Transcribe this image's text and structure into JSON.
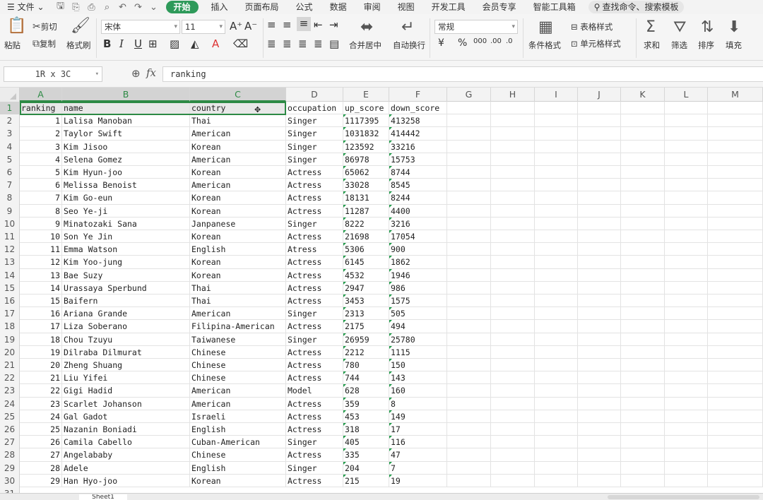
{
  "menu": {
    "file": "文件",
    "items": [
      "开始",
      "插入",
      "页面布局",
      "公式",
      "数据",
      "审阅",
      "视图",
      "开发工具",
      "会员专享",
      "智能工具箱"
    ],
    "active": "开始",
    "search": "查找命令、搜索模板"
  },
  "ribbon": {
    "paste": "粘贴",
    "cut": "剪切",
    "copy": "复制",
    "format_painter": "格式刷",
    "font_name": "宋体",
    "font_size": "11",
    "merge_center": "合并居中",
    "wrap_text": "自动换行",
    "number_format": "常规",
    "conditional_format": "条件格式",
    "table_style": "表格样式",
    "cell_style": "单元格样式",
    "sum": "求和",
    "filter": "筛选",
    "sort": "排序",
    "fill": "填充"
  },
  "formula_bar": {
    "name_box": "1R x 3C",
    "fx": "fx",
    "content": "ranking"
  },
  "columns": [
    "A",
    "B",
    "C",
    "D",
    "E",
    "F",
    "G",
    "H",
    "I",
    "J",
    "K",
    "L",
    "M"
  ],
  "selected_columns": [
    "A",
    "B",
    "C"
  ],
  "selected_row": 1,
  "sheet": {
    "header": [
      "ranking",
      "name",
      "country",
      "occupation",
      "up_score",
      "down_score"
    ],
    "rows": [
      [
        "1",
        "Lalisa Manoban",
        "Thai",
        "Singer",
        "1117395",
        "413258"
      ],
      [
        "2",
        "Taylor Swift",
        "American",
        "Singer",
        "1031832",
        "414442"
      ],
      [
        "3",
        "Kim Jisoo",
        "Korean",
        "Singer",
        "123592",
        "33216"
      ],
      [
        "4",
        "Selena Gomez",
        "American",
        "Singer",
        "86978",
        "15753"
      ],
      [
        "5",
        "Kim Hyun-joo",
        "Korean",
        "Actress",
        "65062",
        "8744"
      ],
      [
        "6",
        "Melissa Benoist",
        "American",
        "Actress",
        "33028",
        "8545"
      ],
      [
        "7",
        "Kim Go-eun",
        "Korean",
        "Actress",
        "18131",
        "8244"
      ],
      [
        "8",
        "Seo Ye-ji",
        "Korean",
        "Actress",
        "11287",
        "4400"
      ],
      [
        "9",
        "Minatozaki Sana",
        "Janpanese",
        "Singer",
        "8222",
        "3216"
      ],
      [
        "10",
        "Son Ye Jin",
        "Korean",
        "Actress",
        "21698",
        "17054"
      ],
      [
        "11",
        "Emma Watson",
        "English",
        "Atress",
        "5306",
        "900"
      ],
      [
        "12",
        "Kim Yoo-jung",
        "Korean",
        "Actress",
        "6145",
        "1862"
      ],
      [
        "13",
        "Bae Suzy",
        "Korean",
        "Actress",
        "4532",
        "1946"
      ],
      [
        "14",
        "Urassaya Sperbund",
        "Thai",
        "Actress",
        "2947",
        "986"
      ],
      [
        "15",
        "Baifern",
        "Thai",
        "Actress",
        "3453",
        "1575"
      ],
      [
        "16",
        "Ariana Grande",
        "American",
        "Singer",
        "2313",
        "505"
      ],
      [
        "17",
        "Liza Soberano",
        "Filipina-American",
        "Actress",
        "2175",
        "494"
      ],
      [
        "18",
        "Chou Tzuyu",
        "Taiwanese",
        "Singer",
        "26959",
        "25780"
      ],
      [
        "19",
        "Dilraba Dilmurat",
        "Chinese",
        "Actress",
        "2212",
        "1115"
      ],
      [
        "20",
        "Zheng Shuang",
        "Chinese",
        "Actress",
        "780",
        "150"
      ],
      [
        "21",
        "Liu Yifei",
        "Chinese",
        "Actress",
        "744",
        "143"
      ],
      [
        "22",
        "Gigi Hadid",
        "American",
        "Model",
        "628",
        "160"
      ],
      [
        "23",
        "Scarlet Johanson",
        "American",
        "Actress",
        "359",
        "8"
      ],
      [
        "24",
        "Gal Gadot",
        "Israeli",
        "Actress",
        "453",
        "149"
      ],
      [
        "25",
        "Nazanin Boniadi",
        "English",
        "Actress",
        "318",
        "17"
      ],
      [
        "26",
        "Camila Cabello",
        "Cuban-American",
        "Singer",
        "405",
        "116"
      ],
      [
        "27",
        "Angelababy",
        "Chinese",
        "Actress",
        "335",
        "47"
      ],
      [
        "28",
        "Adele",
        "English",
        "Singer",
        "204",
        "7"
      ],
      [
        "29",
        "Han Hyo-joo",
        "Korean",
        "Actress",
        "215",
        "19"
      ]
    ]
  },
  "sheet_tab": "Sheet1",
  "colors": {
    "accent": "#2e9a5a",
    "selection": "#2d8a45",
    "text_number_flag": "#1e9b48"
  }
}
